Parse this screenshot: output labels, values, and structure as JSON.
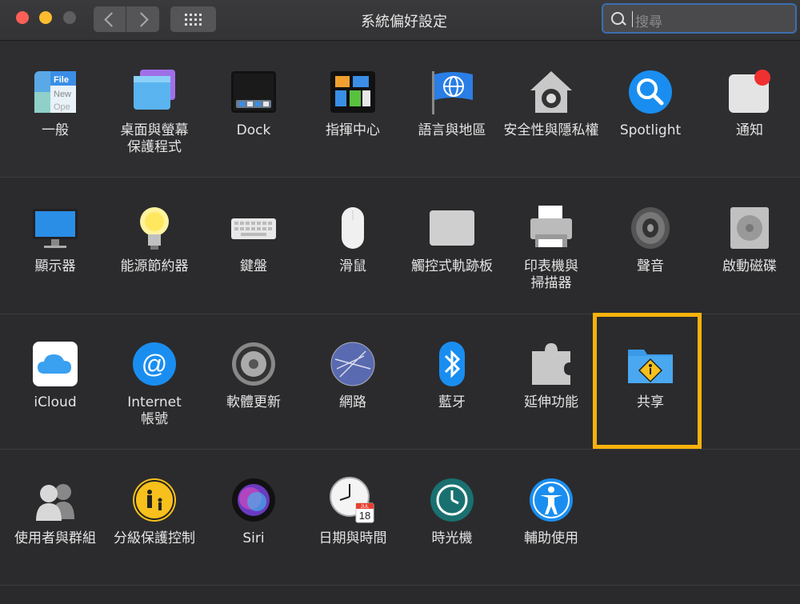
{
  "window": {
    "title": "系統偏好設定",
    "search_placeholder": "搜尋"
  },
  "rows": [
    [
      {
        "label": "一般",
        "icon": "general-icon"
      },
      {
        "label": "桌面與螢幕\n保護程式",
        "icon": "desktop-screensaver-icon"
      },
      {
        "label": "Dock",
        "icon": "dock-icon"
      },
      {
        "label": "指揮中心",
        "icon": "mission-control-icon"
      },
      {
        "label": "語言與地區",
        "icon": "language-region-icon"
      },
      {
        "label": "安全性與隱私權",
        "icon": "security-privacy-icon"
      },
      {
        "label": "Spotlight",
        "icon": "spotlight-icon"
      },
      {
        "label": "通知",
        "icon": "notifications-icon"
      }
    ],
    [
      {
        "label": "顯示器",
        "icon": "displays-icon"
      },
      {
        "label": "能源節約器",
        "icon": "energy-saver-icon"
      },
      {
        "label": "鍵盤",
        "icon": "keyboard-icon"
      },
      {
        "label": "滑鼠",
        "icon": "mouse-icon"
      },
      {
        "label": "觸控式軌跡板",
        "icon": "trackpad-icon"
      },
      {
        "label": "印表機與\n掃描器",
        "icon": "printer-scanner-icon"
      },
      {
        "label": "聲音",
        "icon": "sound-icon"
      },
      {
        "label": "啟動磁碟",
        "icon": "startup-disk-icon"
      }
    ],
    [
      {
        "label": "iCloud",
        "icon": "icloud-icon"
      },
      {
        "label": "Internet\n帳號",
        "icon": "internet-accounts-icon"
      },
      {
        "label": "軟體更新",
        "icon": "software-update-icon"
      },
      {
        "label": "網路",
        "icon": "network-icon"
      },
      {
        "label": "藍牙",
        "icon": "bluetooth-icon"
      },
      {
        "label": "延伸功能",
        "icon": "extensions-icon"
      },
      {
        "label": "共享",
        "icon": "sharing-icon"
      }
    ],
    [
      {
        "label": "使用者與群組",
        "icon": "users-groups-icon"
      },
      {
        "label": "分級保護控制",
        "icon": "parental-controls-icon"
      },
      {
        "label": "Siri",
        "icon": "siri-icon"
      },
      {
        "label": "日期與時間",
        "icon": "date-time-icon"
      },
      {
        "label": "時光機",
        "icon": "time-machine-icon"
      },
      {
        "label": "輔助使用",
        "icon": "accessibility-icon"
      }
    ]
  ],
  "calendar_icon": {
    "month": "JUL",
    "day": "18"
  },
  "highlight_color": "#f7b20c"
}
